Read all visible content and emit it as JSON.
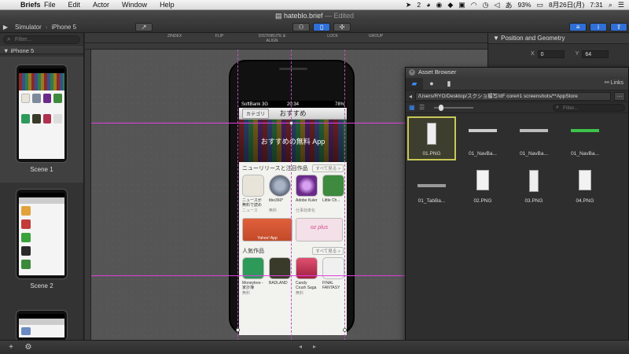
{
  "menubar": {
    "app_name": "Briefs",
    "items": [
      "File",
      "Edit",
      "Actor",
      "Window",
      "Help"
    ],
    "status": {
      "notif_count": "2",
      "battery": "93%",
      "date": "8月26日(月)",
      "time": "7:31"
    }
  },
  "window": {
    "title": "hateblo.brief",
    "edited": "— Edited"
  },
  "toolbar": {
    "breadcrumb_root": "Simulator",
    "breadcrumb_device": "iPhone 5",
    "groups": [
      "ZINDEX",
      "FLIP",
      "DISTRIBUTE & ALIGN",
      "LOCK",
      "GROUP"
    ]
  },
  "sidebar": {
    "filter_placeholder": "Filter...",
    "group_label": "iPhone 5",
    "scenes": [
      "Scene 1",
      "Scene 2"
    ]
  },
  "phone": {
    "status": {
      "carrier": "SoftBank 3G",
      "time": "20:34",
      "battery": "78%"
    },
    "nav_back": "カテゴリ",
    "nav_title": "おすすめ",
    "banner_text": "おすすめの無料 App",
    "section1": {
      "title": "ニューリリースと注目作品",
      "more": "すべて見る >"
    },
    "apps1": [
      {
        "name": "ニュースが無料で読める",
        "category": "ニュース",
        "price": "無料",
        "color": "#e8e4da"
      },
      {
        "name": "tibo360°",
        "category": "無料",
        "price": "",
        "color": "#7e8a9a"
      },
      {
        "name": "Adobe Kuler",
        "category": "仕事効率化",
        "price": "無料",
        "color": "#6a2a8a"
      },
      {
        "name": "Little Ch...",
        "category": "",
        "price": "",
        "color": "#3e8a3e"
      }
    ],
    "promo": {
      "left": "Yahoo! App",
      "right": "oz plus"
    },
    "section2": {
      "title": "人気作品",
      "more": "すべて見る >"
    },
    "apps2": [
      {
        "name": "Moneytree - 家計簿",
        "category": "",
        "price": "無料",
        "color": "#2e9a5a"
      },
      {
        "name": "BADLAND",
        "category": "",
        "price": "",
        "color": "#3a3a2a"
      },
      {
        "name": "Candy Crush Saga",
        "category": "",
        "price": "無料",
        "color": "#b03050"
      },
      {
        "name": "FINAL FANTASY",
        "category": "",
        "price": "",
        "color": "#f0f0f0"
      }
    ]
  },
  "inspector": {
    "title": "Position and Geometry",
    "x_label": "X",
    "x_value": "0",
    "y_label": "Y",
    "y_value": "64"
  },
  "asset_browser": {
    "title": "Asset Browser",
    "links_label": "Links",
    "path": "/Users/RYO/Desktop/スクショ撮写/dF core#1 screenshots/**AppStore",
    "filter_placeholder": "Filter...",
    "files": [
      "01.PNG",
      "01_NavBa...",
      "01_NavBa...",
      "01_NavBa...",
      "01_TabBa...",
      "02.PNG",
      "03.PNG",
      "04.PNG"
    ]
  }
}
